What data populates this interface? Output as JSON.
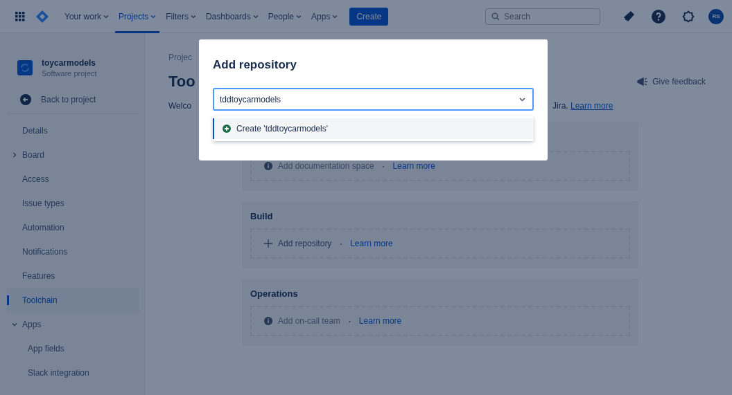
{
  "top_nav": {
    "items": [
      {
        "label": "Your work",
        "selected": false
      },
      {
        "label": "Projects",
        "selected": true
      },
      {
        "label": "Filters",
        "selected": false
      },
      {
        "label": "Dashboards",
        "selected": false
      },
      {
        "label": "People",
        "selected": false
      },
      {
        "label": "Apps",
        "selected": false
      }
    ],
    "create_button": "Create",
    "search": {
      "placeholder": "Search"
    },
    "avatar": "RS"
  },
  "sidebar": {
    "project": {
      "name": "toycarmodels",
      "type": "Software project"
    },
    "back": "Back to project",
    "items": [
      {
        "kind": "link",
        "label": "Details",
        "selected": false
      },
      {
        "kind": "group",
        "label": "Board",
        "selected": false,
        "expanded": false
      },
      {
        "kind": "link",
        "label": "Access",
        "selected": false
      },
      {
        "kind": "link",
        "label": "Issue types",
        "selected": false
      },
      {
        "kind": "link",
        "label": "Automation",
        "selected": false
      },
      {
        "kind": "link",
        "label": "Notifications",
        "selected": false
      },
      {
        "kind": "link",
        "label": "Features",
        "selected": false
      },
      {
        "kind": "link",
        "label": "Toolchain",
        "selected": true
      },
      {
        "kind": "group",
        "label": "Apps",
        "selected": false,
        "expanded": true,
        "children": [
          {
            "kind": "link",
            "label": "App fields",
            "selected": false
          },
          {
            "kind": "link",
            "label": "Slack integration",
            "selected": false
          }
        ]
      }
    ]
  },
  "main": {
    "breadcrumb": "Projec",
    "title": "Too",
    "welcome_start": "Welco",
    "welcome_end": "Jira.",
    "welcome_link": "Learn more",
    "feedback": "Give feedback",
    "sections": [
      {
        "kind": "info",
        "action": "Add documentation space",
        "separator": "•",
        "link": "Learn more"
      },
      {
        "title": "Build",
        "kind": "add",
        "action": "Add repository",
        "separator": "•",
        "link": "Learn more"
      },
      {
        "title": "Operations",
        "kind": "info",
        "action": "Add on-call team",
        "separator": "•",
        "link": "Learn more"
      }
    ]
  },
  "modal": {
    "title": "Add repository",
    "value": "tddtoycarmodels",
    "options": [
      {
        "label": "Create 'tddtoycarmodels'",
        "selected": true
      }
    ]
  }
}
